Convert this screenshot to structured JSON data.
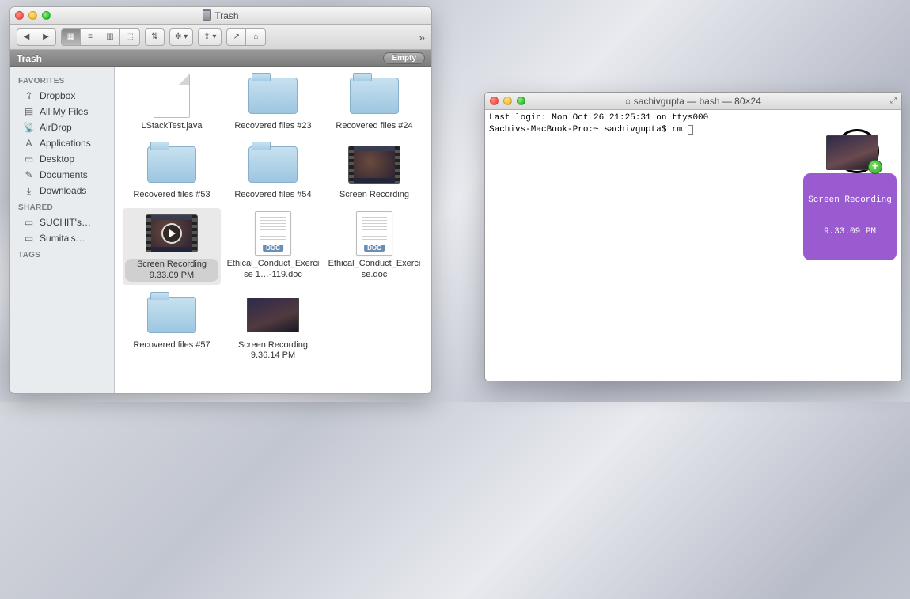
{
  "finder": {
    "title": "Trash",
    "path_label": "Trash",
    "empty_label": "Empty",
    "toolbar": {
      "back_icon": "◀",
      "forward_icon": "▶",
      "view_icons": [
        "▦",
        "≡",
        "▥",
        "⬚"
      ],
      "arrange": "⇅",
      "action": "✻ ▾",
      "dropbox": "⇪ ▾",
      "share": "↗",
      "edit": "⌂",
      "more": "»"
    },
    "sidebar": {
      "sections": [
        {
          "header": "FAVORITES",
          "items": [
            {
              "icon": "⇪",
              "label": "Dropbox"
            },
            {
              "icon": "▤",
              "label": "All My Files"
            },
            {
              "icon": "📡",
              "label": "AirDrop"
            },
            {
              "icon": "A",
              "label": "Applications"
            },
            {
              "icon": "▭",
              "label": "Desktop"
            },
            {
              "icon": "✎",
              "label": "Documents"
            },
            {
              "icon": "⤓",
              "label": "Downloads"
            }
          ]
        },
        {
          "header": "SHARED",
          "items": [
            {
              "icon": "▭",
              "label": "SUCHIT's…"
            },
            {
              "icon": "▭",
              "label": "Sumita's…"
            }
          ]
        },
        {
          "header": "TAGS",
          "items": []
        }
      ]
    },
    "items": [
      {
        "type": "java",
        "name": "LStackTest.java"
      },
      {
        "type": "folder",
        "name": "Recovered files #23"
      },
      {
        "type": "folder",
        "name": "Recovered files #24"
      },
      {
        "type": "folder",
        "name": "Recovered files #53"
      },
      {
        "type": "folder",
        "name": "Recovered files #54"
      },
      {
        "type": "video",
        "name": "Screen Recording"
      },
      {
        "type": "video-play",
        "name": "Screen Recording 9.33.09 PM",
        "selected": true
      },
      {
        "type": "doc",
        "name": "Ethical_Conduct_Exercise 1…-119.doc",
        "tag": "DOC"
      },
      {
        "type": "doc",
        "name": "Ethical_Conduct_Exercise.doc",
        "tag": "DOC"
      },
      {
        "type": "folder",
        "name": "Recovered files #57"
      },
      {
        "type": "screen",
        "name": "Screen Recording 9.36.14 PM"
      }
    ]
  },
  "terminal": {
    "title": "sachivgupta — bash — 80×24",
    "line1": "Last login: Mon Oct 26 21:25:31 on ttys000",
    "line2_prompt": "Sachivs-MacBook-Pro:~ sachivgupta$ ",
    "line2_cmd": "rm ",
    "drag": {
      "label_line1": "Screen Recording",
      "label_line2": "9.33.09 PM"
    }
  }
}
